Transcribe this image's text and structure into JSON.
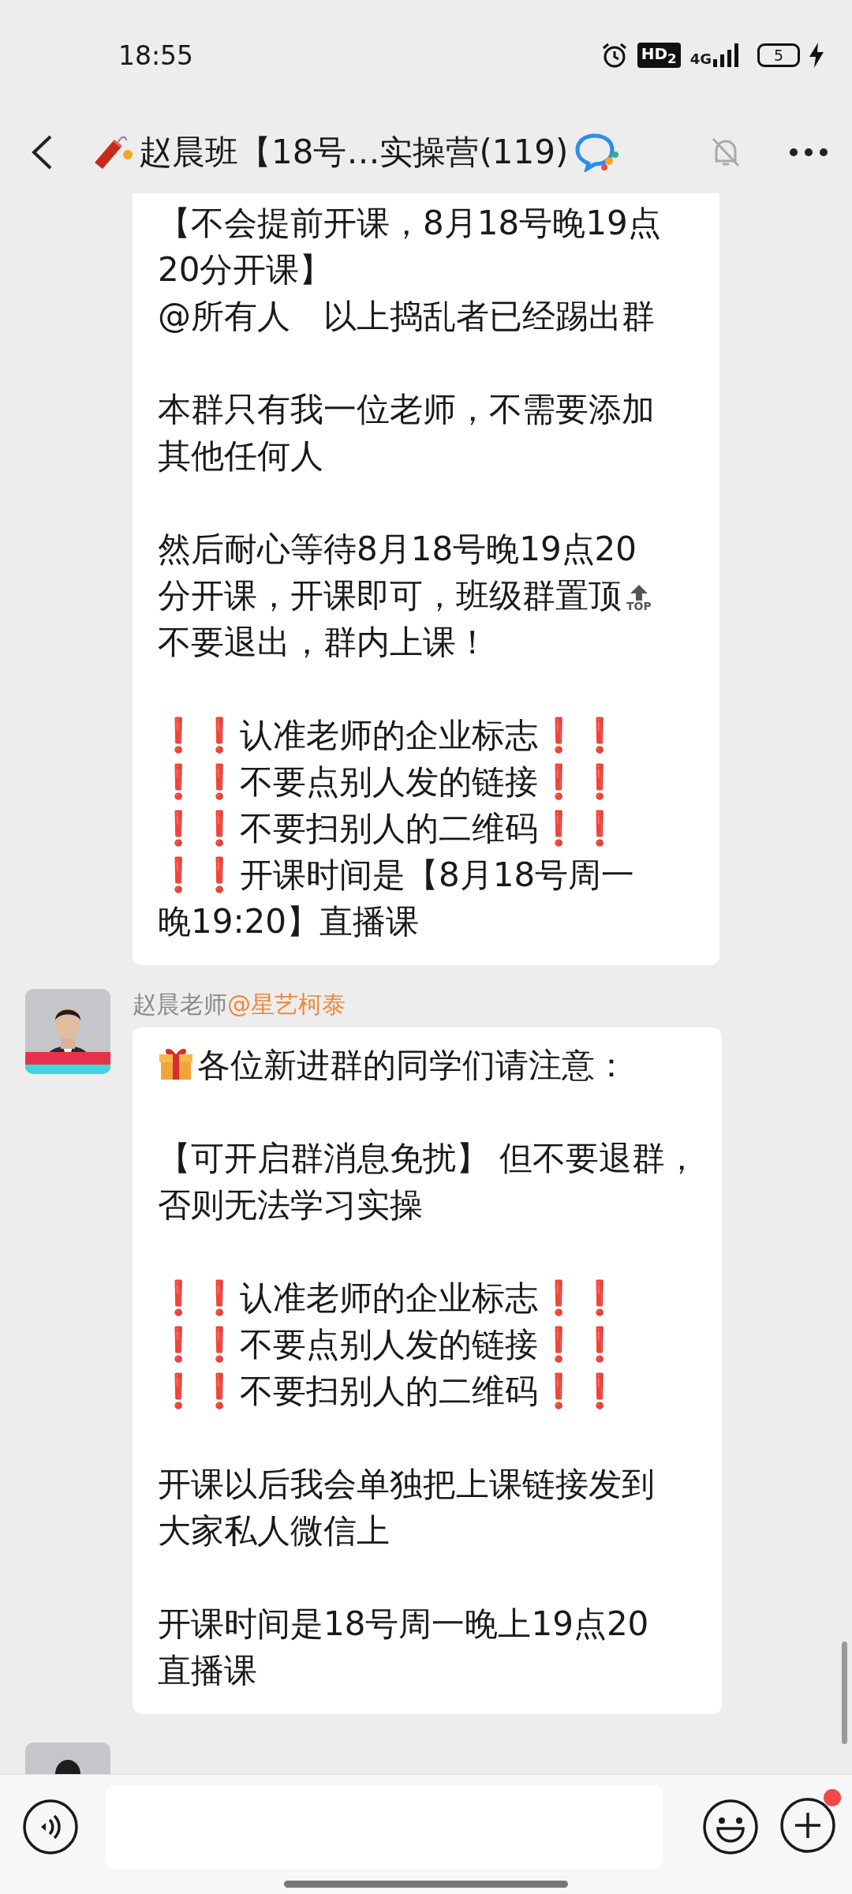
{
  "status_bar": {
    "time": "18:55",
    "hd_badge": "HD$_{2}$",
    "network": "4G",
    "battery": "5",
    "charging": true
  },
  "header": {
    "title": "赵晨班【18号…实操营(119)",
    "muted": true
  },
  "messages": [
    {
      "paragraphs": [
        {
          "lines": [
            {
              "kind": "plain",
              "text": "【不会提前开课，8月18号晚19点"
            },
            {
              "kind": "plain",
              "text": "20分开课】"
            },
            {
              "kind": "plain",
              "text": "@所有人　以上捣乱者已经踢出群"
            }
          ]
        },
        {
          "lines": [
            {
              "kind": "plain",
              "text": "本群只有我一位老师，不需要添加"
            },
            {
              "kind": "plain",
              "text": "其他任何人"
            }
          ]
        },
        {
          "lines": [
            {
              "kind": "plain",
              "text": "然后耐心等待8月18号晚19点20"
            },
            {
              "kind": "top",
              "text": "分开课，开课即可，班级群置顶",
              "badge": "TOP"
            },
            {
              "kind": "plain",
              "text": "不要退出，群内上课！"
            }
          ]
        },
        {
          "lines": [
            {
              "kind": "alert",
              "lead": "❗❗",
              "text": "认准老师的企业标志",
              "trail": "❗❗"
            },
            {
              "kind": "alert",
              "lead": "❗❗",
              "text": "不要点别人发的链接",
              "trail": "❗❗"
            },
            {
              "kind": "alert",
              "lead": "❗❗",
              "text": "不要扫别人的二维码",
              "trail": "❗❗"
            },
            {
              "kind": "alert",
              "lead": "❗❗",
              "text": "开课时间是【8月18号周一"
            },
            {
              "kind": "plain",
              "text": "晚19:20】直播课"
            }
          ]
        }
      ]
    },
    {
      "sender": "赵晨老师",
      "mention": "@星艺柯泰",
      "paragraphs": [
        {
          "lines": [
            {
              "kind": "gift",
              "text": "各位新进群的同学们请注意："
            }
          ]
        },
        {
          "lines": [
            {
              "kind": "plain",
              "text": "【可开启群消息免扰】 但不要退群，"
            },
            {
              "kind": "plain",
              "text": "否则无法学习实操"
            }
          ]
        },
        {
          "lines": [
            {
              "kind": "alert",
              "lead": "❗❗",
              "text": "认准老师的企业标志",
              "trail": "❗❗"
            },
            {
              "kind": "alert",
              "lead": "❗❗",
              "text": "不要点别人发的链接",
              "trail": "❗❗"
            },
            {
              "kind": "alert",
              "lead": "❗❗",
              "text": "不要扫别人的二维码",
              "trail": "❗❗"
            }
          ]
        },
        {
          "lines": [
            {
              "kind": "plain",
              "text": "开课以后我会单独把上课链接发到"
            },
            {
              "kind": "plain",
              "text": "大家私人微信上"
            }
          ]
        },
        {
          "lines": [
            {
              "kind": "plain",
              "text": "开课时间是18号周一晚上19点20"
            },
            {
              "kind": "plain",
              "text": "直播课"
            }
          ]
        }
      ]
    }
  ],
  "composer": {
    "plus_dot": true
  }
}
